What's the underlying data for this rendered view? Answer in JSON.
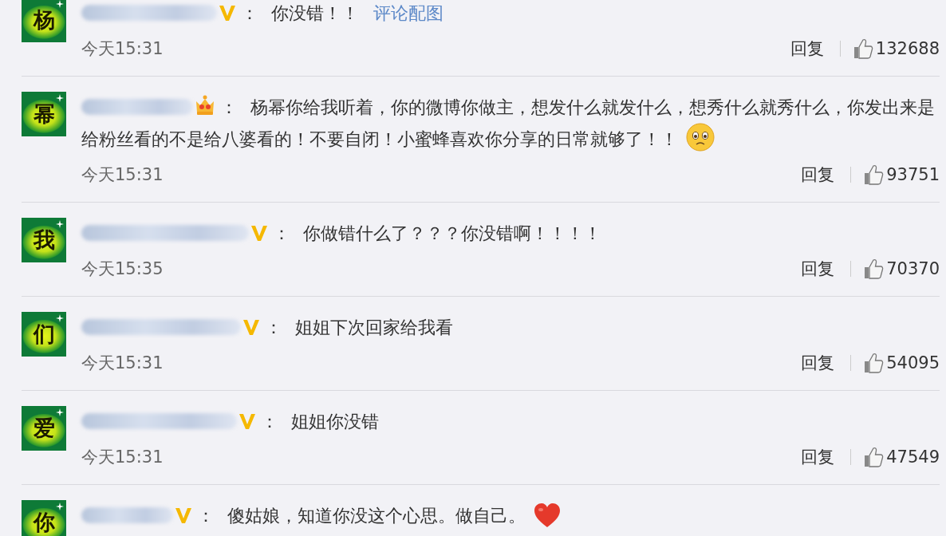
{
  "comments": [
    {
      "avatar": "杨",
      "badge": {
        "kind": "vip"
      },
      "colon": "：",
      "text": [
        "你没错！！"
      ],
      "link": "评论配图",
      "time": "今天15:31",
      "reply": "回复",
      "likes": "132688"
    },
    {
      "avatar": "幂",
      "badge": {
        "kind": "crown"
      },
      "colon": "：",
      "text": [
        "杨幂你给我听着，你的微博你做主，想发什么就发什么，想秀什么就秀什么，你发出来是",
        "给粉丝看的不是给八婆看的！不要自闭！小蜜蜂喜欢你分享的日常就够了！！"
      ],
      "emoji": {
        "kind": "sad"
      },
      "time": "今天15:31",
      "reply": "回复",
      "likes": "93751"
    },
    {
      "avatar": "我",
      "badge": {
        "kind": "vip"
      },
      "colon": "：",
      "text": [
        "你做错什么了？？？你没错啊！！！！"
      ],
      "time": "今天15:35",
      "reply": "回复",
      "likes": "70370"
    },
    {
      "avatar": "们",
      "badge": {
        "kind": "vip"
      },
      "colon": "：",
      "text": [
        "姐姐下次回家给我看"
      ],
      "time": "今天15:31",
      "reply": "回复",
      "likes": "54095"
    },
    {
      "avatar": "爱",
      "badge": {
        "kind": "vip"
      },
      "colon": "：",
      "text": [
        "姐姐你没错"
      ],
      "time": "今天15:31",
      "reply": "回复",
      "likes": "47549"
    },
    {
      "avatar": "你",
      "badge": {
        "kind": "vip"
      },
      "colon": "：",
      "text": [
        "傻姑娘，知道你没这个心思。做自己。"
      ],
      "emoji": {
        "kind": "heart"
      }
    }
  ]
}
